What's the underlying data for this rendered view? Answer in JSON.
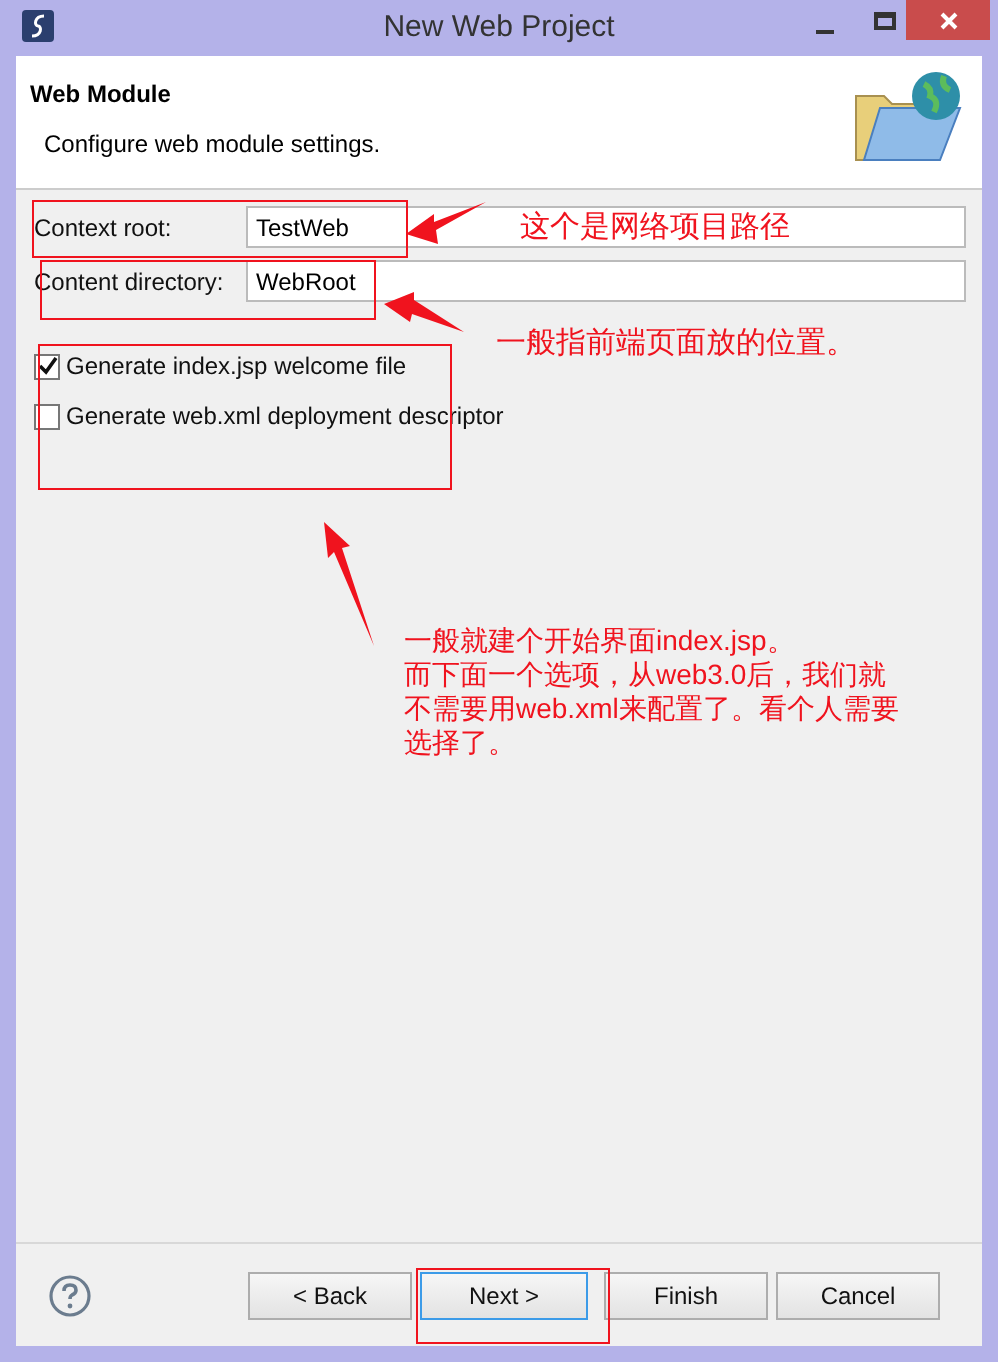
{
  "window": {
    "title": "New Web Project"
  },
  "header": {
    "title": "Web Module",
    "description": "Configure web module settings."
  },
  "fields": [
    {
      "label": "Context root:",
      "value": "TestWeb"
    },
    {
      "label": "Content directory:",
      "value": "WebRoot"
    }
  ],
  "options": [
    {
      "label": "Generate index.jsp welcome file",
      "checked": true
    },
    {
      "label": "Generate web.xml deployment descriptor",
      "checked": false
    }
  ],
  "annotations": [
    {
      "text": "这个是网络项目路径"
    },
    {
      "text": "一般指前端页面放的位置。"
    },
    {
      "lines": [
        "一般就建个开始界面index.jsp。",
        "而下面一个选项，从web3.0后，我们就",
        "不需要用web.xml来配置了。看个人需要",
        "选择了。"
      ]
    }
  ],
  "buttons": [
    {
      "label": "< Back",
      "default": false
    },
    {
      "label": "Next >",
      "default": true
    },
    {
      "label": "Finish",
      "default": false
    },
    {
      "label": "Cancel",
      "default": false
    }
  ]
}
